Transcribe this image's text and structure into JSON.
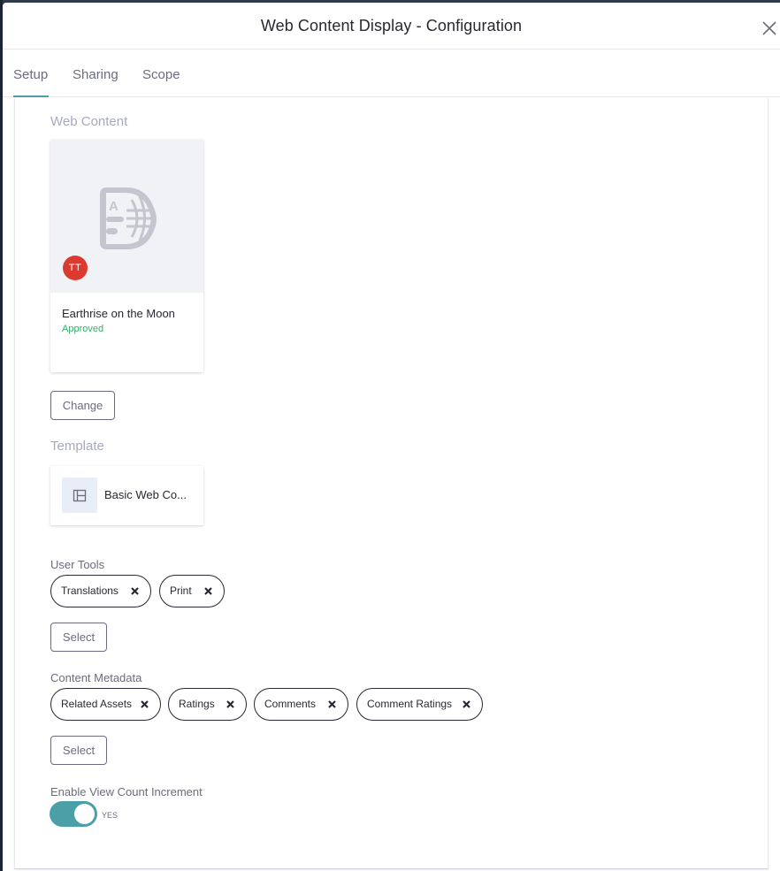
{
  "modal": {
    "title": "Web Content Display - Configuration"
  },
  "tabs": [
    {
      "label": "Setup",
      "active": true
    },
    {
      "label": "Sharing",
      "active": false
    },
    {
      "label": "Scope",
      "active": false
    }
  ],
  "web_content": {
    "section_label": "Web Content",
    "card": {
      "avatar_initials": "TT",
      "avatar_color": "#da3b2e",
      "title": "Earthrise on the Moon",
      "status": "Approved",
      "icon": "web-content-document-icon"
    },
    "change_label": "Change"
  },
  "template": {
    "section_label": "Template",
    "name": "Basic Web Co...",
    "icon": "template-layout-icon"
  },
  "user_tools": {
    "label": "User Tools",
    "chips": [
      "Translations",
      "Print"
    ],
    "select_label": "Select"
  },
  "content_metadata": {
    "label": "Content Metadata",
    "chips": [
      "Related Assets",
      "Ratings",
      "Comments",
      "Comment Ratings"
    ],
    "select_label": "Select"
  },
  "view_count": {
    "label": "Enable View Count Increment",
    "enabled": true,
    "state_label": "YES",
    "accent_color": "#4b9fa6"
  }
}
